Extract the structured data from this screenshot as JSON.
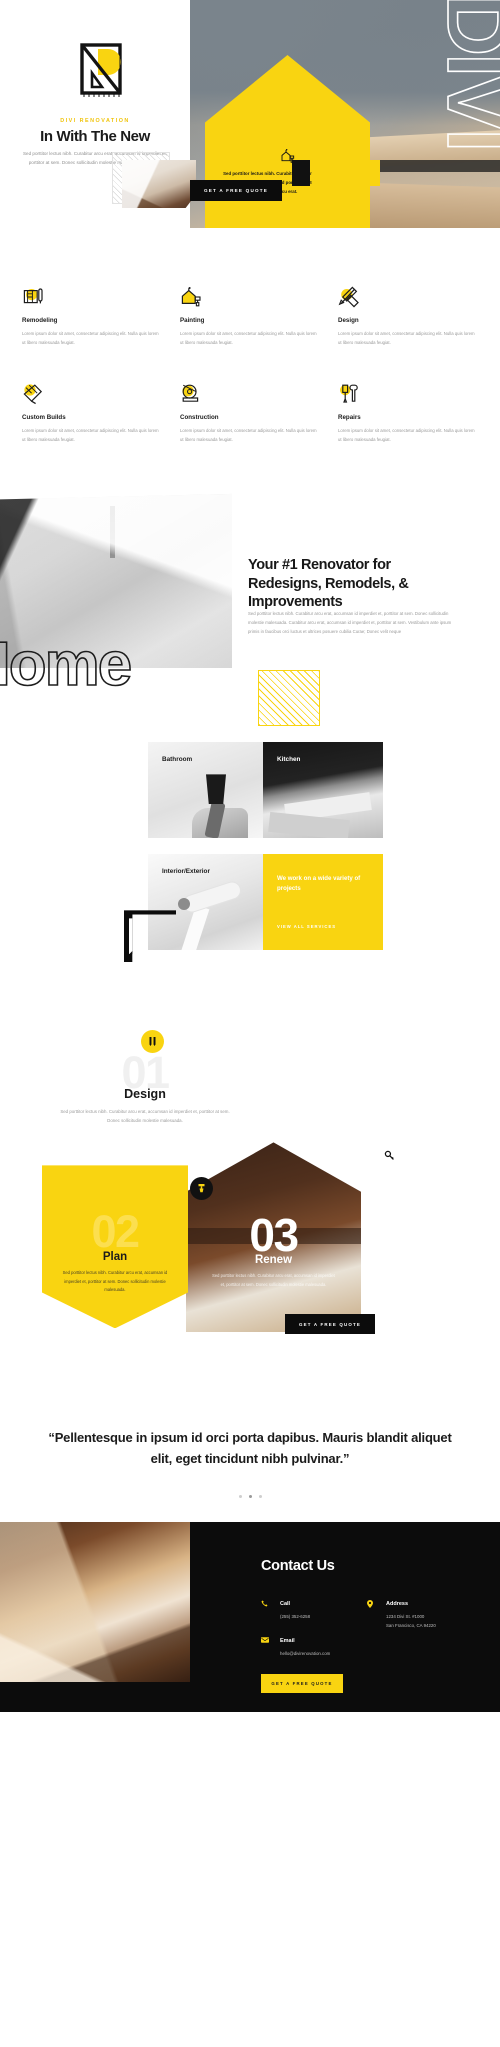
{
  "brand": {
    "eyebrow": "DIVI RENOVATION",
    "logo_icon": "divi-renovation-logo"
  },
  "hero": {
    "title": "In With The New",
    "paragraph": "Sed porttitor lectus nibh. Curabitur arcu erat, accumsan id imperdiet et, porttitor at sem. Donec sollicitudin molestie malesuada. Curabitur",
    "pentagon_icon": "house-paint-roller-icon",
    "pentagon_text": "Sed porttitor lectus nibh. Curabitur arcu erat. Donec  molestie. Accumsan id imperdiet. Sed porttitor lectus nibh. Curabitur arcu erat.",
    "decorative_word": "DIVI",
    "cta_label": "GET A FREE QUOTE"
  },
  "services": [
    {
      "icon": "blueprint-icon",
      "title": "Remodeling",
      "text": "Lorem ipsum dolor sit amet, consectetur adipiscing elit. Nulla quis lorem ut libero malesuada feugiat."
    },
    {
      "icon": "house-paint-icon",
      "title": "Painting",
      "text": "Lorem ipsum dolor sit amet, consectetur adipiscing elit. Nulla quis lorem ut libero malesuada feugiat."
    },
    {
      "icon": "pencil-ruler-icon",
      "title": "Design",
      "text": "Lorem ipsum dolor sit amet, consectetur adipiscing elit. Nulla quis lorem ut libero malesuada feugiat."
    },
    {
      "icon": "trowel-icon",
      "title": "Custom Builds",
      "text": "Lorem ipsum dolor sit amet, consectetur adipiscing elit. Nulla quis lorem ut libero malesuada feugiat."
    },
    {
      "icon": "tape-measure-icon",
      "title": "Construction",
      "text": "Lorem ipsum dolor sit amet, consectetur adipiscing elit. Nulla quis lorem ut libero malesuada feugiat."
    },
    {
      "icon": "screwdriver-wrench-icon",
      "title": "Repairs",
      "text": "Lorem ipsum dolor sit amet, consectetur adipiscing elit. Nulla quis lorem ut libero malesuada feugiat."
    }
  ],
  "renovator": {
    "heading": "Your #1 Renovator for Redesigns, Remodels, & Improvements",
    "paragraph": "Sed porttitor lectus nibh. Curabitur arcu erat, accumsan id imperdiet et, porttitor at sem. Donec sollicitudin molestie malesuada. Curabitur arcu erat, accumsan id imperdiet et, porttitor at sem. Vestibulum ante ipsum primis in faucibus orci luctus et ultrices posuere cubilia Curae; Donec velit neque",
    "decorative_word": "Home"
  },
  "gallery": {
    "cards": [
      {
        "label": "Bathroom",
        "style": "photo-light"
      },
      {
        "label": "Kitchen",
        "style": "photo-dark"
      },
      {
        "label": "Interior/Exterior",
        "style": "photo-light"
      }
    ],
    "promo": {
      "text": "We work on a wide variety of projects",
      "link_label": "VIEW ALL SERVICES"
    }
  },
  "process": {
    "steps": [
      {
        "number": "01",
        "title": "Design",
        "text": "Sed porttitor lectus nibh. Curabitur arcu erat, accumsan id imperdiet et, porttitor at sem. Donec sollicitudin molestie malesuada.",
        "badge_icon": "pencils-icon"
      },
      {
        "number": "02",
        "title": "Plan",
        "text": "Sed porttitor lectus nibh. Curabitur arcu erat, accumsan id imperdiet et, porttitor at sem. Donec sollicitudin molestie malesuada.",
        "badge_icon": "paint-roller-icon"
      },
      {
        "number": "03",
        "title": "Renew",
        "text": "Sed porttitor lectus nibh. Curabitur arcu erat, accumsan id imperdiet et, porttitor at sem. Donec sollicitudin molestie malesuada.",
        "badge_icon": "key-icon"
      }
    ],
    "cta_label": "GET A FREE QUOTE"
  },
  "testimonial": {
    "quote": "“Pellentesque in ipsum id orci porta dapibus. Mauris blandit aliquet elit, eget tincidunt nibh pulvinar.”",
    "slide_count": 3,
    "active_slide": 2
  },
  "footer": {
    "title": "Contact Us",
    "call": {
      "icon": "phone-icon",
      "label": "Call",
      "value": "(255) 352-6258"
    },
    "email": {
      "icon": "envelope-icon",
      "label": "Email",
      "value": "hello@divirenovation.com"
    },
    "address": {
      "icon": "map-pin-icon",
      "label": "Address",
      "line1": "1234 Divi St. #1000",
      "line2": "San Francisco, CA 94220"
    },
    "cta_label": "GET A FREE QUOTE"
  },
  "colors": {
    "accent": "#f9d411",
    "dark": "#0c0c0c",
    "muted": "#9a9a9a"
  }
}
